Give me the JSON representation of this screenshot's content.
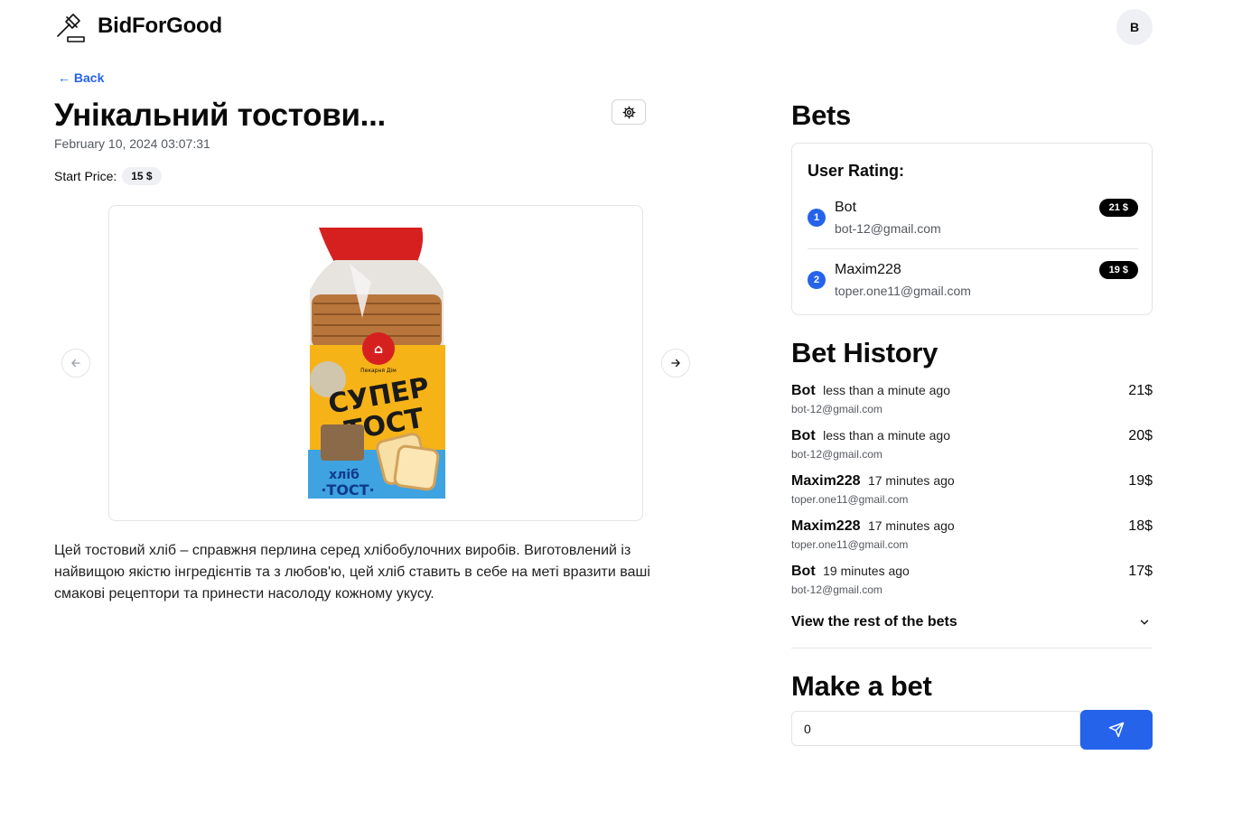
{
  "header": {
    "brand": "BidForGood",
    "avatar_initial": "B"
  },
  "nav": {
    "back_label": "← Back"
  },
  "lot": {
    "title": "Унікальний тостови...",
    "date": "February 10, 2024 03:07:31",
    "start_price_label": "Start Price:",
    "start_price": "15 $",
    "description": "Цей тостовий хліб – справжня перлина серед хлібобулочних виробів. Виготовлений із найвищою якістю інгредієнтів та з любов'ю, цей хліб ставить в себе на меті вразити ваші смакові рецептори та принести насолоду кожному укусу.",
    "product_image": {
      "brand_logo": "Пекарня Дім",
      "line1": "СУПЕР",
      "line2": "ТОСТ",
      "sub1": "хліб",
      "sub2": "·ТОСТ·"
    }
  },
  "bets": {
    "heading": "Bets",
    "rating_title": "User Rating:",
    "rating": [
      {
        "rank": "1",
        "name": "Bot",
        "email": "bot-12@gmail.com",
        "amount": "21 $"
      },
      {
        "rank": "2",
        "name": "Maxim228",
        "email": "toper.one11@gmail.com",
        "amount": "19 $"
      }
    ]
  },
  "history": {
    "heading": "Bet History",
    "items": [
      {
        "name": "Bot",
        "time": "less than a minute ago",
        "email": "bot-12@gmail.com",
        "amount": "21$"
      },
      {
        "name": "Bot",
        "time": "less than a minute ago",
        "email": "bot-12@gmail.com",
        "amount": "20$"
      },
      {
        "name": "Maxim228",
        "time": "17 minutes ago",
        "email": "toper.one11@gmail.com",
        "amount": "19$"
      },
      {
        "name": "Maxim228",
        "time": "17 minutes ago",
        "email": "toper.one11@gmail.com",
        "amount": "18$"
      },
      {
        "name": "Bot",
        "time": "19 minutes ago",
        "email": "bot-12@gmail.com",
        "amount": "17$"
      }
    ],
    "view_rest_label": "View the rest of the bets"
  },
  "make_bet": {
    "heading": "Make a bet",
    "value": "0"
  },
  "colors": {
    "accent": "#2563eb",
    "badge": "#000000",
    "muted": "#55595f",
    "border": "#e2e4e8"
  }
}
